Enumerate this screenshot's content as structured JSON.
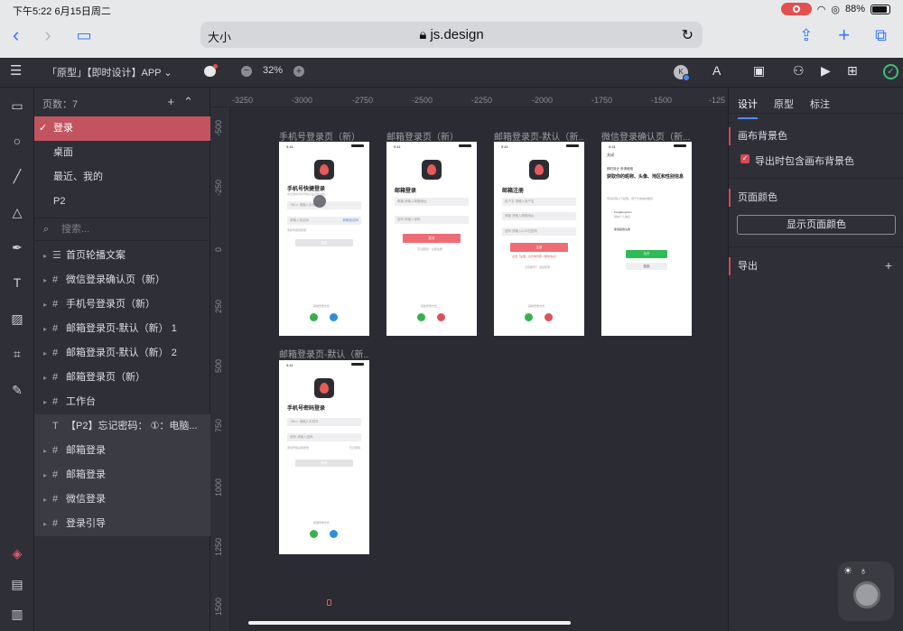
{
  "status": {
    "time": "下午5:22  6月15日周二",
    "battery": "88%"
  },
  "browser": {
    "aa": "大小",
    "host": "js.design"
  },
  "toolbar": {
    "file_title": "「原型」【即时设计】APP",
    "zoom": "32%",
    "user_initial": "K"
  },
  "pages": {
    "count_label": "页数：7",
    "items": [
      "登录",
      "桌面",
      "最近、我的",
      "P2"
    ],
    "search_placeholder": "搜索..."
  },
  "layers": [
    "首页轮播文案",
    "微信登录确认页（新）",
    "手机号登录页（新）",
    "邮箱登录页-默认（新） 1",
    "邮箱登录页-默认（新） 2",
    "邮箱登录页（新）",
    "工作台",
    "【P2】忘记密码： ①：电脑...",
    "邮箱登录",
    "邮箱登录",
    "微信登录",
    "登录引导"
  ],
  "ruler": {
    "top": [
      "-3250",
      "-3000",
      "-2750",
      "-2500",
      "-2250",
      "-2000",
      "-1750",
      "-1500",
      "-125"
    ],
    "left": [
      "-500",
      "-250",
      "0",
      "250",
      "500",
      "750",
      "1000",
      "1250",
      "1500"
    ]
  },
  "frames": {
    "f1": {
      "title": "手机号登录页（新）",
      "heading": "手机号快捷登录",
      "sub": "未注册的手机号验证后自动创建",
      "field1": "+86 ∨  请输入手机号",
      "field2": "请输入验证码",
      "field2_r": "获取验证码",
      "hint": "手机号密码登录",
      "btn": "登录",
      "other": "其他登录方式"
    },
    "f2": {
      "title": "邮箱登录页（新）",
      "heading": "邮箱登录",
      "field1": "邮箱   请输入邮箱地址",
      "field2": "密码   请输入密码",
      "btn": "登录",
      "links": "忘记密码？ 立即注册",
      "other": "其他登录方式"
    },
    "f3": {
      "title": "邮箱登录页-默认（新...",
      "heading": "邮箱注册",
      "field1": "用户名   请输入用户名",
      "field2": "邮箱   请输入邮箱地址",
      "field3": "密码   请输入6-20位密码",
      "btn": "注册",
      "note": "点击「注册」表示你同意《服务协议》",
      "link": "已有账号？ 直接登录",
      "other": "其他登录方式"
    },
    "f4": {
      "title": "微信登录确认页（新...",
      "close": "关闭",
      "app": "即时设计 申请使用",
      "heading": "获取你的昵称、头像、地区和性别信息",
      "hint": "申请获取以下权限，用于为你提供服务",
      "acct1": "Kongkong Kim",
      "acct1_sub": "微信个人信息",
      "acct2": "使用其他头像",
      "btn": "允许",
      "cancel": "拒绝"
    },
    "f5": {
      "title": "邮箱登录页-默认（新...",
      "heading": "手机号密码登录",
      "field1": "+86 ∨  请输入手机号",
      "field2": "密码   请输入密码",
      "hint_l": "手机号验证码登录",
      "hint_r": "忘记密码",
      "btn": "登录",
      "other": "其他登录方式"
    }
  },
  "right_panel": {
    "tabs": [
      "设计",
      "原型",
      "标注"
    ],
    "canvas_bg": "画布背景色",
    "export_bg": "导出时包含画布背景色",
    "page_color": "页面颜色",
    "show_page_color": "显示页面颜色",
    "export": "导出"
  },
  "colors": {
    "accent": "#c2545f",
    "blue": "#4a8ef0",
    "panel": "#2f3037",
    "canvas": "#2b2c33"
  }
}
